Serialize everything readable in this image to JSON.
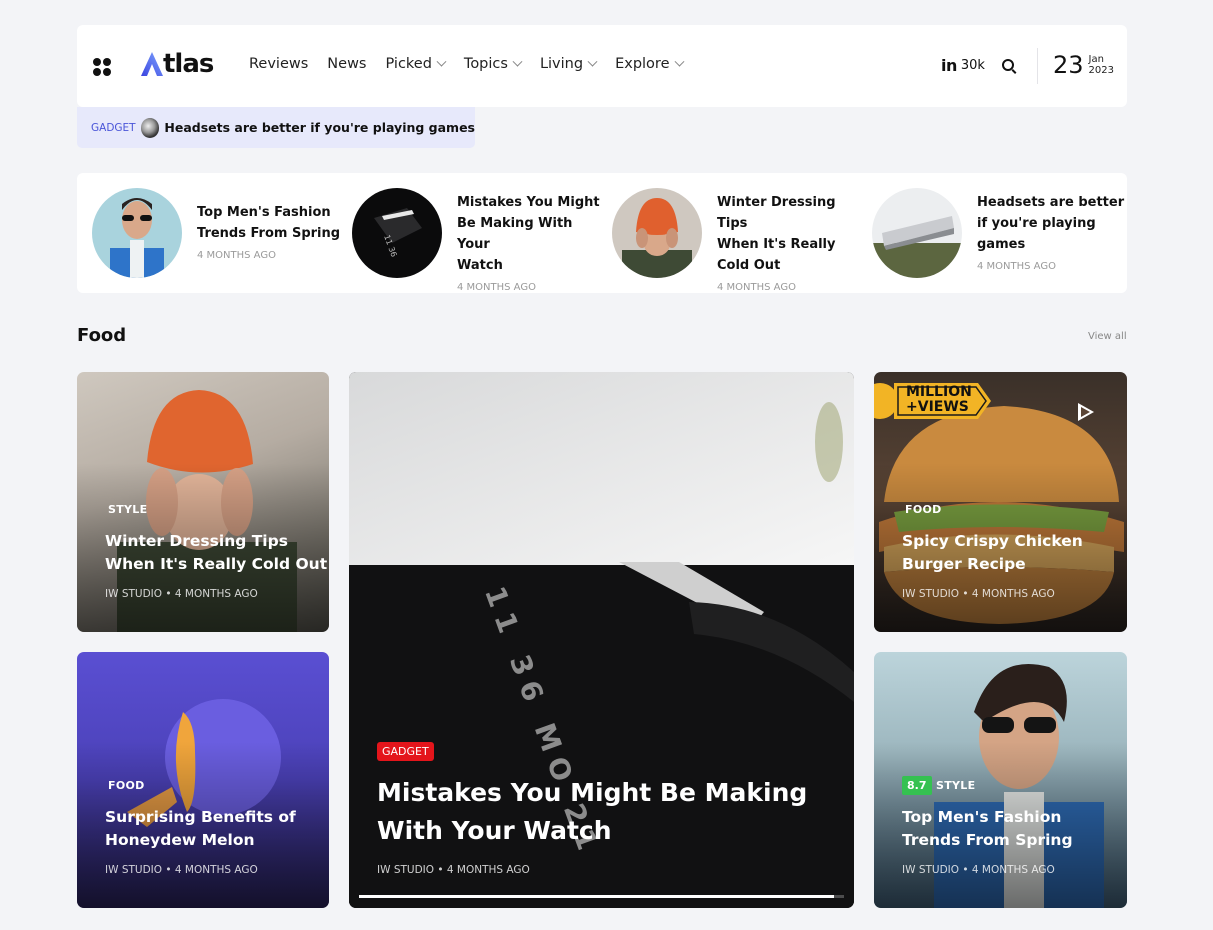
{
  "header": {
    "logo": "Atlas",
    "nav": [
      {
        "label": "Reviews",
        "dropdown": false
      },
      {
        "label": "News",
        "dropdown": false
      },
      {
        "label": "Picked",
        "dropdown": true
      },
      {
        "label": "Topics",
        "dropdown": true
      },
      {
        "label": "Living",
        "dropdown": true
      },
      {
        "label": "Explore",
        "dropdown": true
      }
    ],
    "social": {
      "network": "in",
      "count": "30k"
    },
    "date": {
      "day": "23",
      "month": "Jan",
      "year": "2023"
    }
  },
  "ticker": {
    "category": "GADGET",
    "title": "Headsets are better if you're playing games"
  },
  "trending": [
    {
      "title_lines": [
        "Top Men's Fashion",
        "Trends From Spring"
      ],
      "meta": "4 MONTHS AGO"
    },
    {
      "title_lines": [
        "Mistakes You Might",
        "Be Making With Your",
        "Watch"
      ],
      "meta": "4 MONTHS AGO"
    },
    {
      "title_lines": [
        "Winter Dressing Tips",
        "When It's Really",
        "Cold Out"
      ],
      "meta": "4 MONTHS AGO"
    },
    {
      "title_lines": [
        "Headsets are better",
        "if you're playing",
        "games"
      ],
      "meta": "4 MONTHS AGO"
    }
  ],
  "section": {
    "title": "Food",
    "view_all": "View all"
  },
  "cards": {
    "c1": {
      "category": "STYLE",
      "title_lines": [
        "Winter Dressing Tips",
        "When It's Really Cold Out"
      ],
      "meta": "IW STUDIO • 4 MONTHS AGO"
    },
    "c2": {
      "category": "FOOD",
      "title_lines": [
        "Surprising Benefits of",
        "Honeydew Melon"
      ],
      "meta": "IW STUDIO • 4 MONTHS AGO"
    },
    "c3": {
      "category": "GADGET",
      "title_lines": [
        "Mistakes You Might Be Making",
        "With Your Watch"
      ],
      "meta": "IW STUDIO • 4 MONTHS AGO",
      "progress": 0.98,
      "watch_text": [
        "11",
        "36",
        "MO",
        "21"
      ]
    },
    "c4": {
      "category": "FOOD",
      "title_lines": [
        "Spicy Crispy Chicken",
        "Burger Recipe"
      ],
      "meta": "IW STUDIO • 4 MONTHS AGO",
      "badge_lines": [
        "MILLION",
        "+VIEWS"
      ]
    },
    "c5": {
      "category": "STYLE",
      "rating": "8.7",
      "title_lines": [
        "Top Men's Fashion",
        "Trends From Spring"
      ],
      "meta": "IW STUDIO • 4 MONTHS AGO"
    }
  },
  "colors": {
    "accent": "#4a55d8",
    "ticker_bg": "#e7e9fb",
    "gadget_red": "#e4151b",
    "rating_green": "#35c151"
  }
}
